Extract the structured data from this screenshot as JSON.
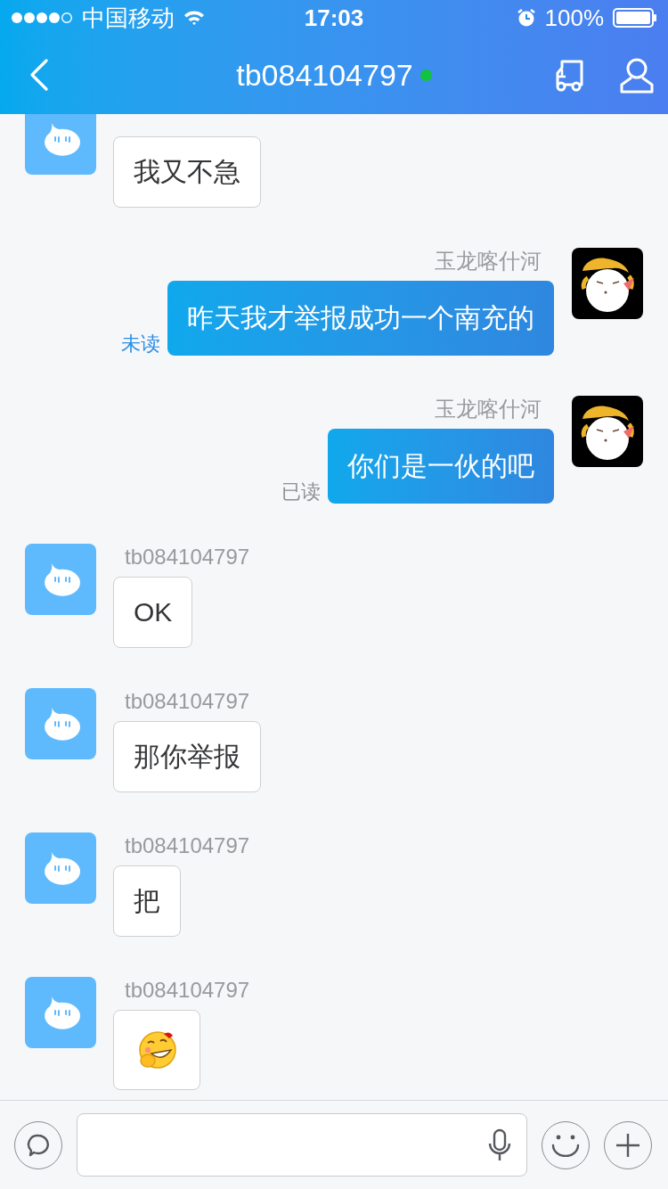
{
  "status_bar": {
    "carrier": "中国移动",
    "time": "17:03",
    "battery": "100%"
  },
  "header": {
    "title": "tb084104797",
    "online": true
  },
  "messages": [
    {
      "kind": "incoming",
      "text": "我又不急"
    },
    {
      "kind": "outgoing",
      "sender": "玉龙喀什河",
      "text": "昨天我才举报成功一个南充的",
      "read_label": "未读",
      "read": false
    },
    {
      "kind": "outgoing",
      "sender": "玉龙喀什河",
      "text": "你们是一伙的吧",
      "read_label": "已读",
      "read": true
    },
    {
      "kind": "incoming",
      "sender": "tb084104797",
      "text": "OK"
    },
    {
      "kind": "incoming",
      "sender": "tb084104797",
      "text": "那你举报"
    },
    {
      "kind": "incoming",
      "sender": "tb084104797",
      "text": "把"
    },
    {
      "kind": "sticker",
      "sender": "tb084104797"
    }
  ]
}
